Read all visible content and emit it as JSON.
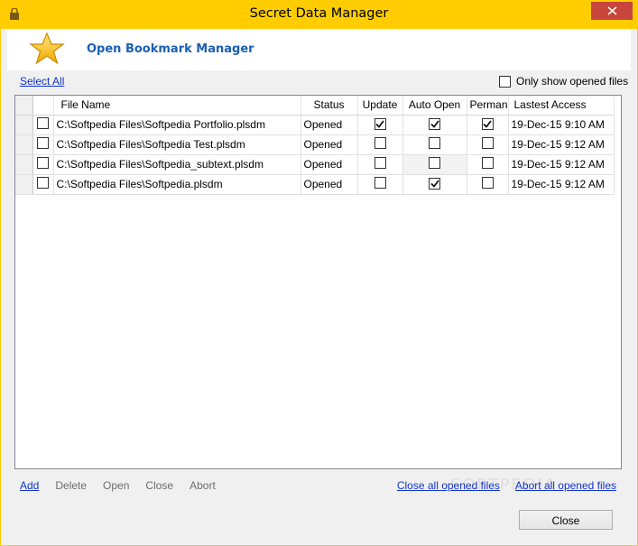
{
  "window": {
    "title": "Secret Data Manager"
  },
  "colors": {
    "titlebar": "#ffcc00",
    "close": "#c7453a",
    "header_title": "#1a5fb4",
    "link": "#1133cc"
  },
  "header": {
    "title": "Open Bookmark Manager"
  },
  "toolbar": {
    "select_all": "Select All",
    "only_show_opened": "Only show opened files"
  },
  "table": {
    "columns": [
      "File Name",
      "Status",
      "Update",
      "Auto Open",
      "Permane",
      "Lastest Access"
    ],
    "rows": [
      {
        "file": "C:\\Softpedia Files\\Softpedia Portfolio.plsdm",
        "status": "Opened",
        "update": true,
        "auto_open": true,
        "permanent": true,
        "last_access": "19-Dec-15 9:10 AM"
      },
      {
        "file": "C:\\Softpedia Files\\Softpedia Test.plsdm",
        "status": "Opened",
        "update": false,
        "auto_open": false,
        "permanent": false,
        "last_access": "19-Dec-15 9:12 AM"
      },
      {
        "file": "C:\\Softpedia Files\\Softpedia_subtext.plsdm",
        "status": "Opened",
        "update": false,
        "auto_open": false,
        "permanent": false,
        "last_access": "19-Dec-15 9:12 AM"
      },
      {
        "file": "C:\\Softpedia Files\\Softpedia.plsdm",
        "status": "Opened",
        "update": false,
        "auto_open": true,
        "permanent": false,
        "last_access": "19-Dec-15 9:12 AM"
      }
    ]
  },
  "actions": {
    "add": "Add",
    "delete": "Delete",
    "open": "Open",
    "close": "Close",
    "abort": "Abort",
    "close_all": "Close all opened files",
    "abort_all": "Abort all opened files"
  },
  "footer": {
    "close_button": "Close"
  },
  "watermark": "SOFTPEDIA"
}
